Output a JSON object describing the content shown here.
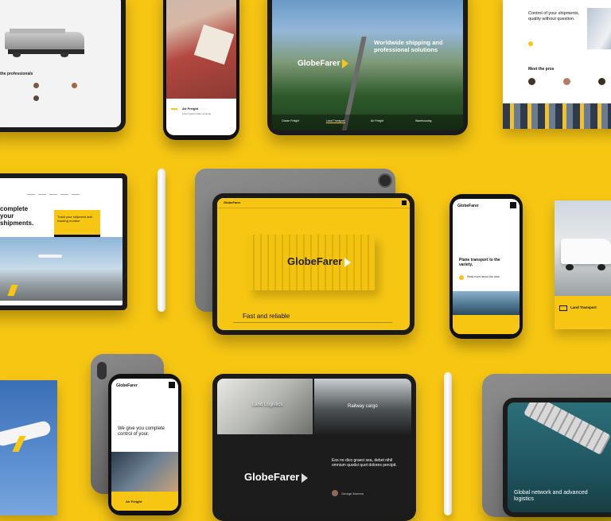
{
  "brand": {
    "name": "GlobeFarer",
    "accent": "#f7c613",
    "dark": "#1b1b1b"
  },
  "tiles": {
    "train_laptop": {
      "heading": "the professionals"
    },
    "phone_air": {
      "label": "Air Freight"
    },
    "hero_tablet": {
      "brand": "GlobeFarer",
      "headline": "Worldwide shipping and professional solutions",
      "nav": [
        "Ocean Freight",
        "Land Transport",
        "Air Freight",
        "Warehousing"
      ]
    },
    "paper_top_right": {
      "heading": "Control of your shipments, quality without question.",
      "pros": "Meet the pros"
    },
    "laptop_track": {
      "heading": "complete your shipments.",
      "cta": "Track your shipment add tracking number"
    },
    "center_tablet": {
      "brand": "GlobeFarer",
      "container_text": "GlobeFarer",
      "tagline": "Fast and reliable"
    },
    "phone_center": {
      "brand": "GlobeFarer",
      "headline": "Plane transport to the variety.",
      "card": "Read more about the area"
    },
    "paper_right_mid": {
      "label": "Land Transport"
    },
    "phone_bottom": {
      "brand": "GlobeFarer",
      "headline": "We give you complete control of your.",
      "label": "Air Freight"
    },
    "bottom_tablet": {
      "tile1": "Land Logistics",
      "tile2": "Railway cargo",
      "brand": "GlobeFarer",
      "quote": "Eos no dico graeci sea, debet nihil omnium quodsi quot dolores percipit.",
      "author": "George Moreno"
    },
    "bottom_right_tablet": {
      "headline": "Global network and advanced logistics"
    }
  },
  "icons": [
    "chevron-logo-icon",
    "menu-icon",
    "arrow-icon",
    "truck-icon",
    "plane-icon",
    "avatar-icon"
  ]
}
